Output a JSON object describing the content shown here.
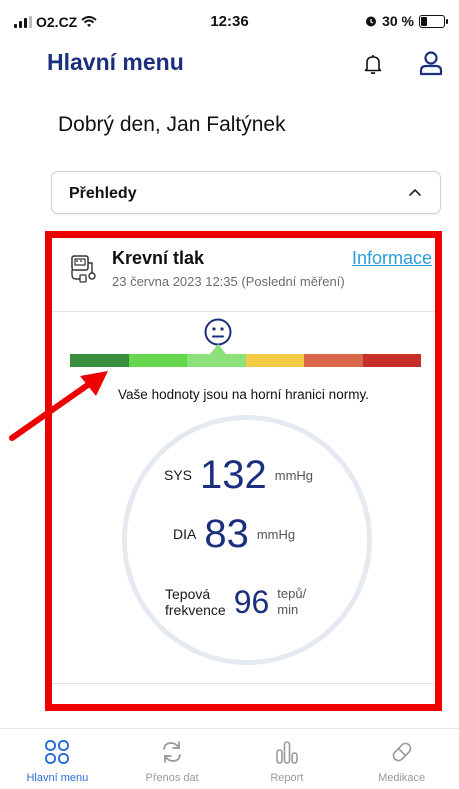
{
  "status_bar": {
    "carrier": "O2.CZ",
    "time": "12:36",
    "battery": "30 %",
    "battery_level": 0.3
  },
  "header": {
    "title": "Hlavní menu"
  },
  "greeting": "Dobrý den, Jan Faltýnek",
  "overview_dropdown": {
    "label": "Přehledy"
  },
  "blood_pressure_card": {
    "title": "Krevní tlak",
    "subtitle": "23 června 2023 12:35 (Poslední měření)",
    "info_link": "Informace",
    "scale_colors": [
      "#388e3c",
      "#66d64e",
      "#8ee07a",
      "#f2cc45",
      "#d9674c",
      "#c62f2a"
    ],
    "scale_indicator_segment": 2,
    "status_text": "Vaše hodnoty jsou na horní hranici normy.",
    "sys": {
      "label": "SYS",
      "value": "132",
      "unit": "mmHg"
    },
    "dia": {
      "label": "DIA",
      "value": "83",
      "unit": "mmHg"
    },
    "pulse": {
      "label_line1": "Tepová",
      "label_line2": "frekvence",
      "value": "96",
      "unit_line1": "tepů/",
      "unit_line2": "min"
    }
  },
  "colors": {
    "brand_navy": "#1c2f7f",
    "link_blue": "#2b9ddc",
    "highlight_red": "#ee0000",
    "active_tab": "#2b6fd6"
  },
  "bottom_nav": {
    "items": [
      {
        "label": "Hlavní menu",
        "icon": "grid-icon",
        "active": true
      },
      {
        "label": "Přenos dat",
        "icon": "sync-icon",
        "active": false
      },
      {
        "label": "Report",
        "icon": "report-icon",
        "active": false
      },
      {
        "label": "Medikace",
        "icon": "pill-icon",
        "active": false
      }
    ]
  }
}
